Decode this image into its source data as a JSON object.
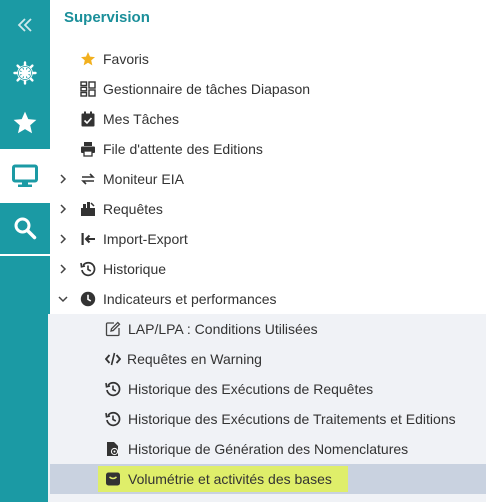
{
  "rail": {
    "items": [
      {
        "icon": "double-chevron-left-icon",
        "selected": false
      },
      {
        "icon": "helm-icon",
        "selected": false
      },
      {
        "icon": "star-icon",
        "selected": false
      },
      {
        "icon": "monitor-icon",
        "selected": true
      },
      {
        "icon": "search-icon",
        "selected": false
      }
    ]
  },
  "panel": {
    "title": "Supervision",
    "items": [
      {
        "label": "Favoris",
        "icon": "star-icon"
      },
      {
        "label": "Gestionnaire de tâches Diapason",
        "icon": "task-manager-icon"
      },
      {
        "label": "Mes Tâches",
        "icon": "calendar-check-icon"
      },
      {
        "label": "File d'attente des Editions",
        "icon": "printer-icon"
      },
      {
        "label": "Moniteur EIA",
        "icon": "sync-icon"
      },
      {
        "label": "Requêtes",
        "icon": "query-icon"
      },
      {
        "label": "Import-Export",
        "icon": "import-export-icon"
      },
      {
        "label": "Historique",
        "icon": "history-icon"
      },
      {
        "label": "Indicateurs et performances",
        "icon": "clock-icon"
      }
    ],
    "subitems": [
      {
        "label": "LAP/LPA : Conditions Utilisées",
        "icon": "edit-icon"
      },
      {
        "label": "Requêtes en Warning",
        "icon": "code-icon"
      },
      {
        "label": "Historique des Exécutions de Requêtes",
        "icon": "history-icon"
      },
      {
        "label": "Historique des Exécutions de Traitements et Editions",
        "icon": "history-icon"
      },
      {
        "label": "Historique de Génération des Nomenclatures",
        "icon": "file-gear-icon"
      },
      {
        "label": "Volumétrie et activités des bases",
        "icon": "database-icon"
      }
    ]
  },
  "colors": {
    "rail": "#1b9aa4",
    "title": "#1b8f9a",
    "favorite_star": "#f2b01e",
    "highlight_row": "#c9d2e0",
    "highlight_text": "#dfee6a"
  }
}
